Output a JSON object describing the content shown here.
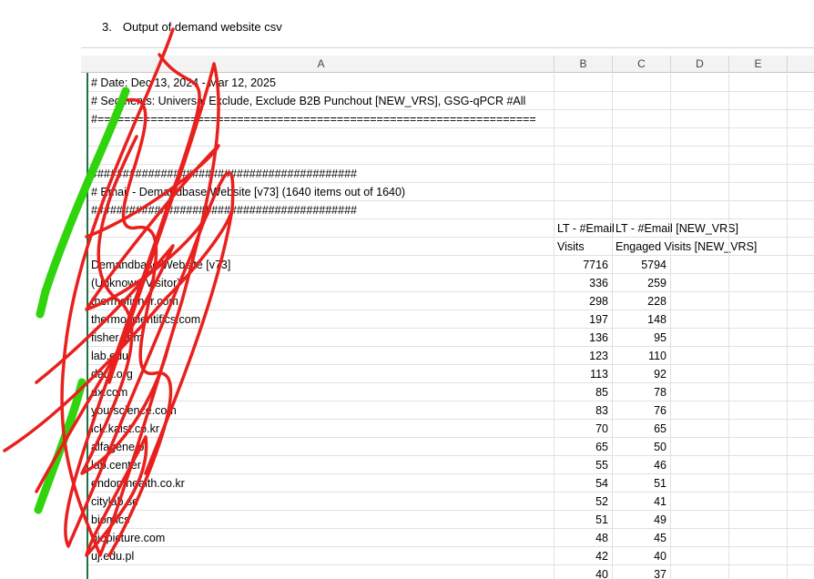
{
  "document": {
    "list_number": "3.",
    "heading": "Output of demand website csv"
  },
  "sheet": {
    "columns": [
      "A",
      "B",
      "C",
      "D",
      "E"
    ],
    "meta_rows": [
      "# Date: Dec 13, 2024 - Mar 12, 2025",
      "# Segments: Universal Exclude, Exclude B2B Punchout [NEW_VRS], GSG-qPCR #All",
      "#==================================================================",
      "",
      "",
      "##########################################",
      "# Email - Demandbase Website [v73] (1640 items out of 1640)",
      "##########################################"
    ],
    "header_row_1": {
      "b": "LT - #Email",
      "c": "LT - #Email [NEW_VRS]"
    },
    "header_row_2": {
      "b": "Visits",
      "c": "Engaged Visits [NEW_VRS]"
    },
    "rows": [
      {
        "a": "Demandbase Website [v73]",
        "b": "7716",
        "c": "5794"
      },
      {
        "a": "(Unknown Visitor)",
        "b": "336",
        "c": "259"
      },
      {
        "a": "thermofisher.com",
        "b": "298",
        "c": "228"
      },
      {
        "a": "thermoscientifics.com",
        "b": "197",
        "c": "148"
      },
      {
        "a": "fisher.com",
        "b": "136",
        "c": "95"
      },
      {
        "a": "lab.edu",
        "b": "123",
        "c": "110"
      },
      {
        "a": "data.org",
        "b": "113",
        "c": "92"
      },
      {
        "a": "dx.com",
        "b": "85",
        "c": "78"
      },
      {
        "a": "yourscience.com",
        "b": "83",
        "c": "76"
      },
      {
        "a": "lck.kaist.co.kr",
        "b": "70",
        "c": "65"
      },
      {
        "a": "alfagene.pt",
        "b": "65",
        "c": "50"
      },
      {
        "a": "lab.center",
        "b": "55",
        "c": "46"
      },
      {
        "a": "endomhealth.co.kr",
        "b": "54",
        "c": "51"
      },
      {
        "a": "citylab.se",
        "b": "52",
        "c": "41"
      },
      {
        "a": "biomics",
        "b": "51",
        "c": "49"
      },
      {
        "a": "biopicture.com",
        "b": "48",
        "c": "45"
      },
      {
        "a": "uj.edu.pl",
        "b": "42",
        "c": "40"
      },
      {
        "a": "",
        "b": "40",
        "c": "37"
      }
    ]
  },
  "annotations": {
    "scribble_red": "#e8201e",
    "scribble_green": "#2fd40d"
  }
}
